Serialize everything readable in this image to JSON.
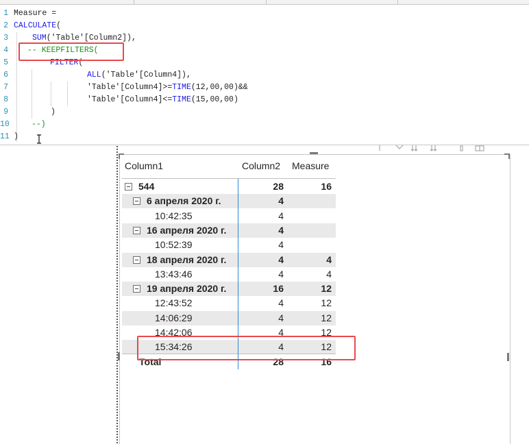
{
  "editor": {
    "line_numbers": [
      "1",
      "2",
      "3",
      "4",
      "5",
      "6",
      "7",
      "8",
      "9",
      "10",
      "11"
    ],
    "lines": {
      "l1": "Measure =",
      "l2_fn": "CALCULATE",
      "l2_rest": "(",
      "l3_fn": "SUM",
      "l3_rest": "('Table'[Column2]),",
      "l4_comment": "-- KEEPFILTERS(",
      "l5_fn": "FILTER",
      "l5_rest": "(",
      "l6_fn": "ALL",
      "l6_rest": "('Table'[Column4]),",
      "l7_a": "'Table'[Column4]>=",
      "l7_fn": "TIME",
      "l7_b": "(12,00,00)&&",
      "l8_a": "'Table'[Column4]<=",
      "l8_fn": "TIME",
      "l8_b": "(15,00,00)",
      "l9": ")",
      "l10": "--)",
      "l11": ")"
    }
  },
  "matrix": {
    "headers": {
      "col1": "Column1",
      "col2": "Column2",
      "col3": "Measure"
    },
    "rows": [
      {
        "label": "544",
        "col2": "28",
        "col3": "16",
        "bold": true,
        "shade": false,
        "level": 0,
        "expander": true
      },
      {
        "label": "6 апреля 2020 г.",
        "col2": "4",
        "col3": "",
        "bold": true,
        "shade": true,
        "level": 1,
        "expander": true
      },
      {
        "label": "10:42:35",
        "col2": "4",
        "col3": "",
        "bold": false,
        "shade": false,
        "level": 2,
        "expander": false
      },
      {
        "label": "16 апреля 2020 г.",
        "col2": "4",
        "col3": "",
        "bold": true,
        "shade": true,
        "level": 1,
        "expander": true
      },
      {
        "label": "10:52:39",
        "col2": "4",
        "col3": "",
        "bold": false,
        "shade": false,
        "level": 2,
        "expander": false
      },
      {
        "label": "18 апреля 2020 г.",
        "col2": "4",
        "col3": "4",
        "bold": true,
        "shade": true,
        "level": 1,
        "expander": true
      },
      {
        "label": "13:43:46",
        "col2": "4",
        "col3": "4",
        "bold": false,
        "shade": false,
        "level": 2,
        "expander": false
      },
      {
        "label": "19 апреля 2020 г.",
        "col2": "16",
        "col3": "12",
        "bold": true,
        "shade": true,
        "level": 1,
        "expander": true
      },
      {
        "label": "12:43:52",
        "col2": "4",
        "col3": "12",
        "bold": false,
        "shade": false,
        "level": 2,
        "expander": false
      },
      {
        "label": "14:06:29",
        "col2": "4",
        "col3": "12",
        "bold": false,
        "shade": true,
        "level": 2,
        "expander": false
      },
      {
        "label": "14:42:06",
        "col2": "4",
        "col3": "12",
        "bold": false,
        "shade": false,
        "level": 2,
        "expander": false
      },
      {
        "label": "15:34:26",
        "col2": "4",
        "col3": "12",
        "bold": false,
        "shade": true,
        "level": 2,
        "expander": false
      }
    ],
    "total": {
      "label": "Total",
      "col2": "28",
      "col3": "16"
    }
  },
  "colors": {
    "highlight_box": "#e8484d",
    "column_divider": "#2f87d6",
    "keyword_blue": "#1a1ae6",
    "comment_green": "#1a8f1a",
    "row_shade": "#e9e9e9"
  },
  "icons": [
    "i-beam-cursor-icon",
    "expand-collapse-icon",
    "filter-icon",
    "sort-icon",
    "focus-mode-icon",
    "more-options-icon"
  ]
}
